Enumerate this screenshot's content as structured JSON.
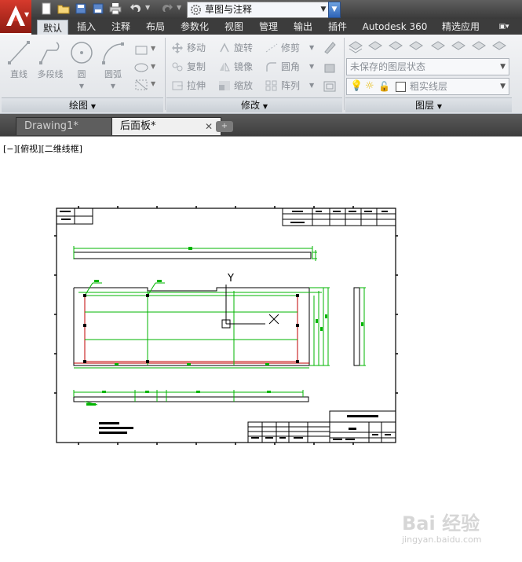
{
  "app": {
    "name": "AutoCAD"
  },
  "qat": {
    "workspace": "草图与注释"
  },
  "ribbon_tabs": [
    {
      "label": "默认",
      "active": true
    },
    {
      "label": "插入"
    },
    {
      "label": "注释"
    },
    {
      "label": "布局"
    },
    {
      "label": "参数化"
    },
    {
      "label": "视图"
    },
    {
      "label": "管理"
    },
    {
      "label": "输出"
    },
    {
      "label": "插件"
    },
    {
      "label": "Autodesk 360"
    },
    {
      "label": "精选应用"
    }
  ],
  "draw_panel": {
    "title": "绘图",
    "tools": [
      "直线",
      "多段线",
      "圆",
      "圆弧"
    ]
  },
  "modify_panel": {
    "title": "修改",
    "tools": [
      "移动",
      "旋转",
      "修剪",
      "复制",
      "镜像",
      "圆角",
      "拉伸",
      "缩放",
      "阵列"
    ]
  },
  "layers_panel": {
    "title": "图层",
    "layer_state": "未保存的图层状态",
    "current_layer": "粗实线层"
  },
  "doc_tabs": [
    "Drawing1*",
    "后面板*"
  ],
  "viewport": {
    "label": "[−][俯视][二维线框]"
  },
  "watermark": {
    "line1": "Bai 经验",
    "line2": "jingyan.baidu.com"
  },
  "colors": {
    "accent": "#3d7fd6",
    "drawing_green": "#00b400",
    "drawing_red": "#c00000",
    "ribbon_dark": "#3c3c3c"
  }
}
